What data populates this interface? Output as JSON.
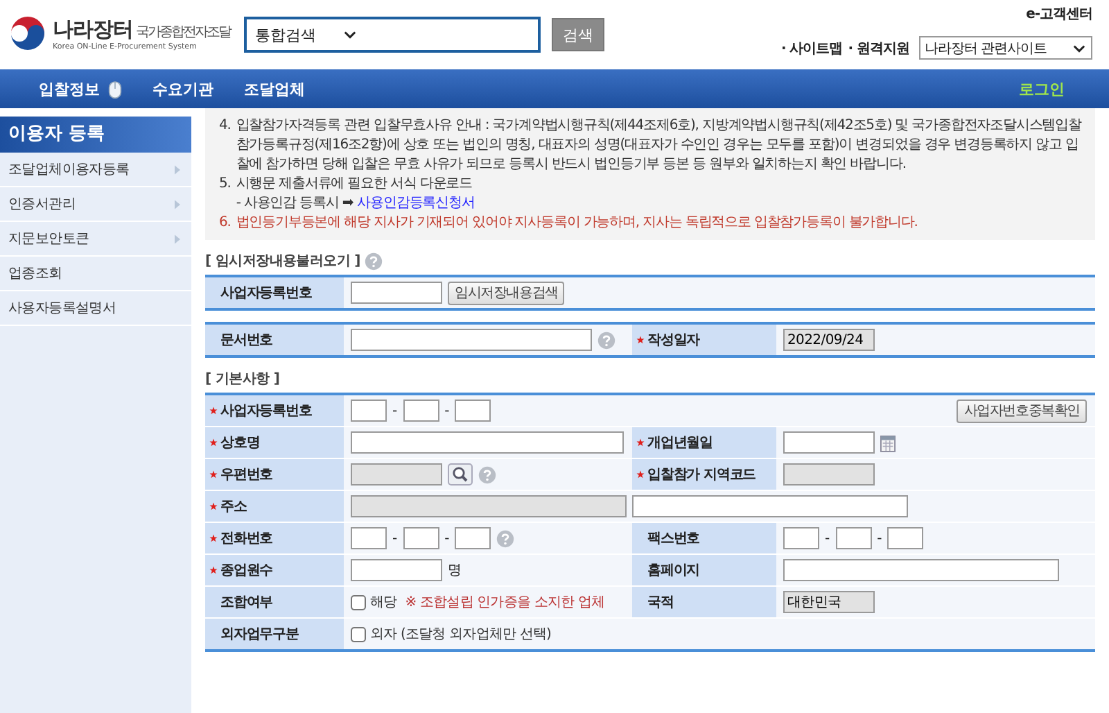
{
  "header": {
    "logo": {
      "title": "나라장터",
      "subtitle": "국가종합전자조달",
      "english": "Korea ON-Line E-Procurement System"
    },
    "search": {
      "scope": "통합검색",
      "button": "검색"
    },
    "customer_center": "e-고객센터",
    "site_links": [
      "· 사이트맵",
      "· 원격지원"
    ],
    "related_select": "나라장터 관련사이트"
  },
  "nav": {
    "items": [
      {
        "label": "입찰정보",
        "selected": false,
        "icon": true
      },
      {
        "label": "수요기관",
        "selected": false,
        "icon": false
      },
      {
        "label": "조달업체",
        "selected": false,
        "icon": false
      }
    ],
    "login": "로그인"
  },
  "sidebar": {
    "title": "이용자 등록",
    "items": [
      {
        "label": "조달업체이용자등록",
        "has_submenu": true
      },
      {
        "label": "인증서관리",
        "has_submenu": true
      },
      {
        "label": "지문보안토큰",
        "has_submenu": true
      },
      {
        "label": "업종조회",
        "has_submenu": false
      },
      {
        "label": "사용자등록설명서",
        "has_submenu": false
      }
    ]
  },
  "notice": {
    "items": [
      {
        "number": "4.",
        "kind": "normal",
        "text": "입찰참가자격등록 관련 입찰무효사유 안내 : 국가계약법시행규칙(제44조제6호), 지방계약법시행규칙(제42조5호) 및 국가종합전자조달시스템입찰참가등록규정(제16조2항)에 상호 또는 법인의 명칭, 대표자의 성명(대표자가 수인인 경우는 모두를 포함)이 변경되었을 경우 변경등록하지 않고 입찰에 참가하면 당해 입찰은 무효 사유가 되므로 등록시 반드시 법인등기부 등본 등 원부와 일치하는지 확인 바랍니다."
      },
      {
        "number": "5.",
        "kind": "normal",
        "text": "시행문 제출서류에 필요한 서식 다운로드",
        "sub": {
          "prefix": "- 사용인감 등록시 ➡",
          "link": "사용인감등록신청서"
        }
      },
      {
        "number": "6.",
        "kind": "warning",
        "text": "법인등기부등본에 해당 지사가 기재되어 있어야 지사등록이 가능하며, 지사는 독립적으로 입찰참가등록이 불가합니다."
      }
    ]
  },
  "sections": [
    {
      "title": "[ 임시저장내용불러오기 ]",
      "help": true,
      "rows": [
        {
          "cells": [
            {
              "label": "사업자등록번호",
              "required": false,
              "wide": true,
              "fields": [
                {
                  "kind": "short",
                  "readonly": false
                },
                {
                  "kind": "button",
                  "label": "임시저장내용검색"
                }
              ]
            }
          ]
        }
      ]
    },
    {
      "help": false,
      "rows": [
        {
          "cells": [
            {
              "label": "문서번호",
              "required": false,
              "wide": false,
              "fields": [
                {
                  "kind": "medium",
                  "readonly": false
                },
                {
                  "kind": "help"
                }
              ]
            },
            {
              "label": "작성일자",
              "required": true,
              "wide": false,
              "fields": [
                {
                  "kind": "short",
                  "readonly": true,
                  "value": "2022/09/24"
                }
              ]
            }
          ]
        }
      ]
    },
    {
      "title": "[ 기본사항 ]",
      "help": false,
      "rows": [
        {
          "cells": [
            {
              "label": "사업자등록번호",
              "required": true,
              "wide": true,
              "fields": [
                {
                  "kind": "segment",
                  "readonly": false
                },
                {
                  "kind": "text",
                  "text": "-"
                },
                {
                  "kind": "segment",
                  "readonly": false
                },
                {
                  "kind": "text",
                  "text": "-"
                },
                {
                  "kind": "segment",
                  "readonly": false
                },
                {
                  "kind": "side_button",
                  "label": "사업자번호중복확인"
                }
              ]
            }
          ]
        },
        {
          "cells": [
            {
              "label": "상호명",
              "required": true,
              "wide": false,
              "fields": [
                {
                  "kind": "long",
                  "readonly": false
                }
              ]
            },
            {
              "label": "개업년월일",
              "required": true,
              "wide": false,
              "fields": [
                {
                  "kind": "short",
                  "readonly": false
                },
                {
                  "kind": "calendar"
                }
              ]
            }
          ]
        },
        {
          "cells": [
            {
              "label": "우편번호",
              "required": true,
              "wide": false,
              "fields": [
                {
                  "kind": "short",
                  "readonly": true
                },
                {
                  "kind": "search"
                },
                {
                  "kind": "help"
                }
              ]
            },
            {
              "label": "입찰참가 지역코드",
              "required": true,
              "wide": false,
              "fields": [
                {
                  "kind": "short",
                  "readonly": true
                }
              ]
            }
          ]
        },
        {
          "cells": [
            {
              "label": "주소",
              "required": true,
              "wide": true,
              "fields": [
                {
                  "kind": "long",
                  "readonly": true
                },
                {
                  "kind": "long",
                  "readonly": false
                }
              ]
            }
          ]
        },
        {
          "cells": [
            {
              "label": "전화번호",
              "required": true,
              "wide": false,
              "fields": [
                {
                  "kind": "segment",
                  "readonly": false
                },
                {
                  "kind": "text",
                  "text": "-"
                },
                {
                  "kind": "segment",
                  "readonly": false
                },
                {
                  "kind": "text",
                  "text": "-"
                },
                {
                  "kind": "segment",
                  "readonly": false
                },
                {
                  "kind": "help"
                }
              ]
            },
            {
              "label": "팩스번호",
              "required": false,
              "wide": false,
              "fields": [
                {
                  "kind": "segment",
                  "readonly": false
                },
                {
                  "kind": "text",
                  "text": "-"
                },
                {
                  "kind": "segment",
                  "readonly": false
                },
                {
                  "kind": "text",
                  "text": "-"
                },
                {
                  "kind": "segment",
                  "readonly": false
                }
              ]
            }
          ]
        },
        {
          "cells": [
            {
              "label": "종업원수",
              "required": true,
              "wide": false,
              "fields": [
                {
                  "kind": "short",
                  "readonly": false
                },
                {
                  "kind": "text",
                  "text": "명"
                }
              ]
            },
            {
              "label": "홈페이지",
              "required": false,
              "wide": false,
              "fields": [
                {
                  "kind": "long",
                  "readonly": false
                }
              ]
            }
          ]
        },
        {
          "cells": [
            {
              "label": "조합여부",
              "required": false,
              "wide": false,
              "fields": [
                {
                  "kind": "checkbox",
                  "checked": false,
                  "label": "해당",
                  "note": "※ 조합설립 인가증을 소지한 업체"
                }
              ]
            },
            {
              "label": "국적",
              "required": false,
              "wide": false,
              "fields": [
                {
                  "kind": "short",
                  "readonly": true,
                  "value": "대한민국"
                }
              ]
            }
          ]
        },
        {
          "cells": [
            {
              "label": "외자업무구분",
              "required": false,
              "wide": true,
              "fields": [
                {
                  "kind": "checkbox",
                  "checked": false,
                  "label": "외자 (조달청 외자업체만 선택)"
                }
              ]
            }
          ]
        }
      ]
    }
  ]
}
